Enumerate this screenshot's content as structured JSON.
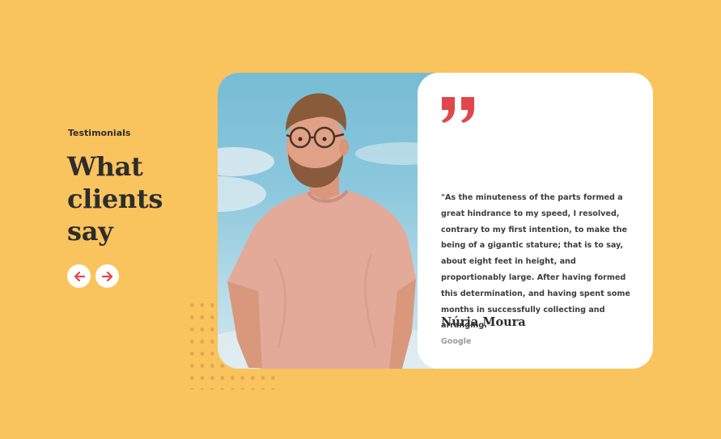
{
  "section": {
    "eyebrow": "Testimonials",
    "title": "What clients say"
  },
  "nav": {
    "prev_icon": "arrow-left-icon",
    "next_icon": "arrow-right-icon"
  },
  "testimonial": {
    "quote": "\"As the minuteness of the parts formed a great hindrance to my speed, I resolved, contrary to my first intention, to make the being of a gigantic stature; that is to say, about eight feet in height, and proportionably large. After having formed this determination, and having spent some months in successfully collecting and arranging.\"",
    "name": "Núria Moura",
    "company": "Google",
    "quote_icon": "quote-icon",
    "photo": "person-photo"
  },
  "colors": {
    "background": "#f9c35e",
    "accent": "#e0474c",
    "card": "#ffffff",
    "text": "#2d2d2d"
  }
}
